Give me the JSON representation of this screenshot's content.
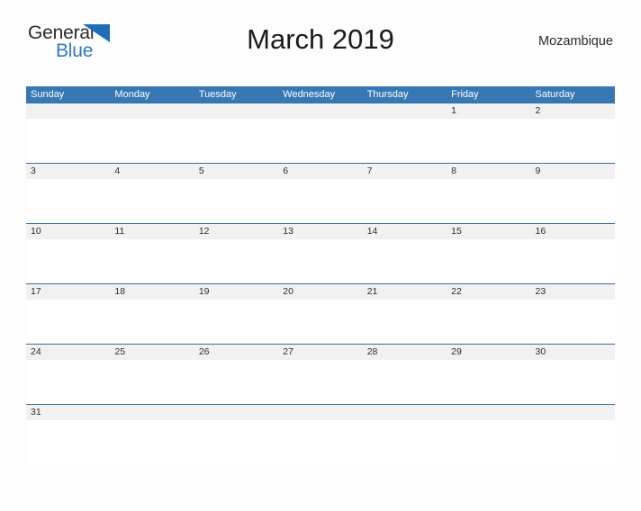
{
  "logo": {
    "line1": "General",
    "line2": "Blue",
    "flag_icon": "blue-triangle-flag-icon",
    "color_general": "#2b2b2b",
    "color_blue": "#2f79bd"
  },
  "header": {
    "title": "March 2019",
    "country": "Mozambique"
  },
  "colors": {
    "header_blue": "#3778b4",
    "row_divider_blue": "#2f6fa8",
    "day_band_gray": "#f1f1f1",
    "page_background": "#fdfdfd",
    "text_dark": "#2c2c2c"
  },
  "calendar": {
    "weekdays": [
      "Sunday",
      "Monday",
      "Tuesday",
      "Wednesday",
      "Thursday",
      "Friday",
      "Saturday"
    ],
    "weeks": [
      {
        "days": [
          "",
          "",
          "",
          "",
          "",
          "1",
          "2"
        ]
      },
      {
        "days": [
          "3",
          "4",
          "5",
          "6",
          "7",
          "8",
          "9"
        ]
      },
      {
        "days": [
          "10",
          "11",
          "12",
          "13",
          "14",
          "15",
          "16"
        ]
      },
      {
        "days": [
          "17",
          "18",
          "19",
          "20",
          "21",
          "22",
          "23"
        ]
      },
      {
        "days": [
          "24",
          "25",
          "26",
          "27",
          "28",
          "29",
          "30"
        ]
      },
      {
        "days": [
          "31",
          "",
          "",
          "",
          "",
          "",
          ""
        ]
      }
    ]
  }
}
